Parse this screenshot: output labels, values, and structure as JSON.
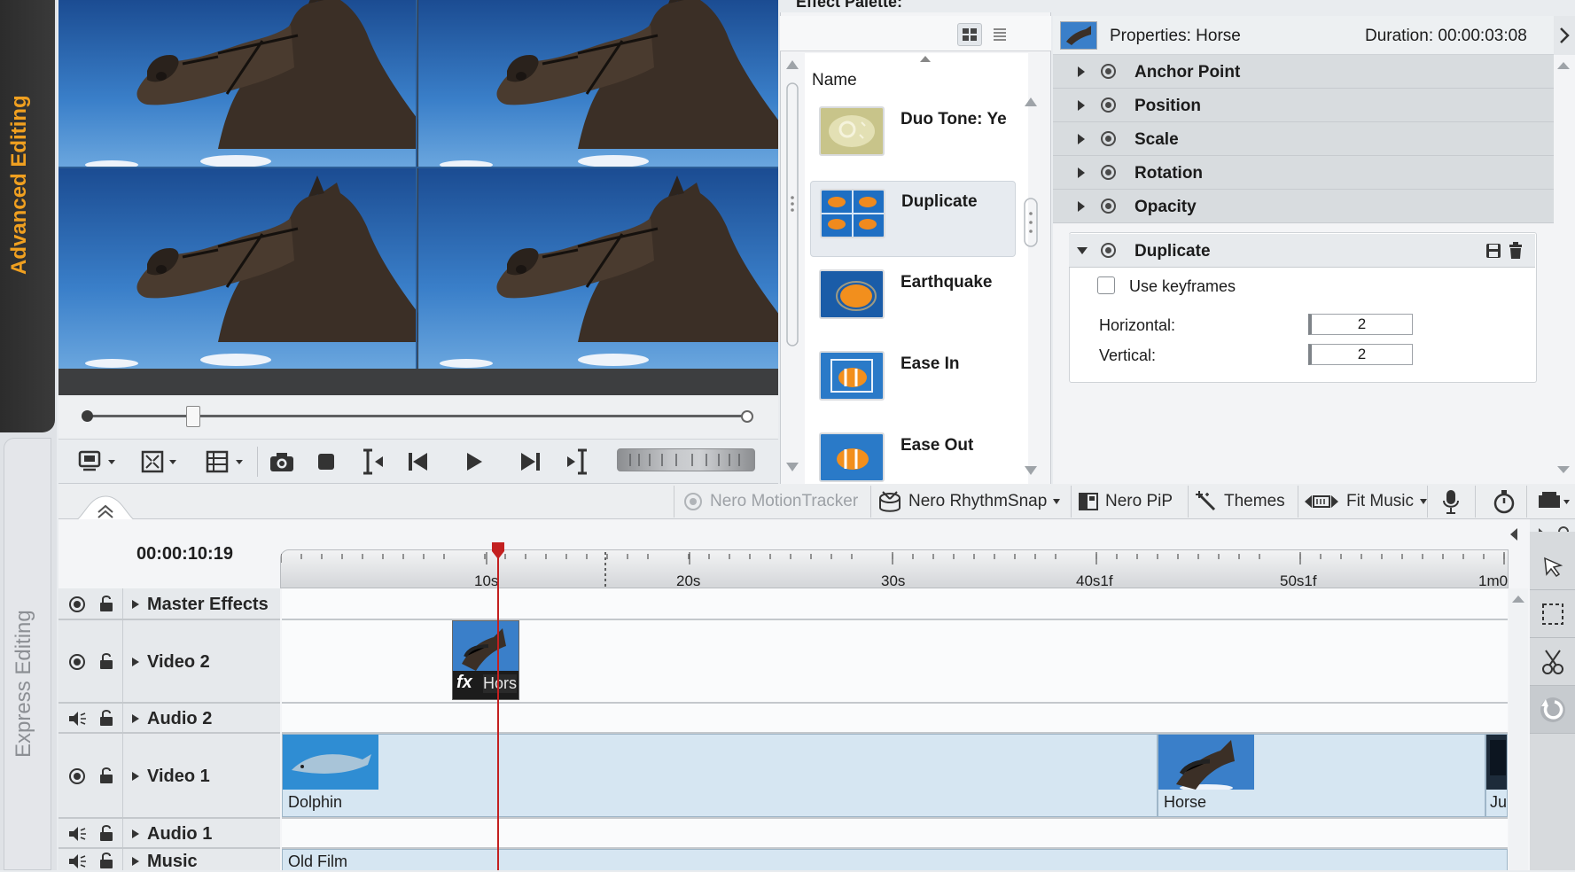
{
  "mode_tabs": {
    "advanced": "Advanced Editing",
    "express": "Express Editing"
  },
  "palette": {
    "title": "Effect Palette:",
    "column_header": "Name",
    "items": [
      {
        "name": "Duo Tone: Ye",
        "thumb": "duotone"
      },
      {
        "name": "Duplicate",
        "thumb": "duplicate",
        "selected": true
      },
      {
        "name": "Earthquake",
        "thumb": "fish"
      },
      {
        "name": "Ease In",
        "thumb": "clownfish"
      },
      {
        "name": "Ease Out",
        "thumb": "clownfish"
      }
    ]
  },
  "properties": {
    "title_prefix": "Properties:",
    "clip_name": "Horse",
    "duration_label": "Duration:",
    "duration_value": "00:00:03:08",
    "groups": [
      "Anchor Point",
      "Position",
      "Scale",
      "Rotation",
      "Opacity"
    ],
    "effect": {
      "name": "Duplicate",
      "use_keyframes_label": "Use keyframes",
      "use_keyframes_checked": false,
      "horizontal_label": "Horizontal:",
      "horizontal_value": "2",
      "vertical_label": "Vertical:",
      "vertical_value": "2"
    }
  },
  "toolbar": {
    "motion_tracker": "Nero MotionTracker",
    "rhythm_snap": "Nero RhythmSnap",
    "pip": "Nero PiP",
    "themes": "Themes",
    "fit_music": "Fit Music"
  },
  "timeline": {
    "timecode": "00:00:10:19",
    "ticks": [
      "10s",
      "20s",
      "30s",
      "40s1f",
      "50s1f",
      "1m0"
    ],
    "tracks": [
      {
        "name": "Master Effects",
        "kind": "fx"
      },
      {
        "name": "Video 2",
        "kind": "video"
      },
      {
        "name": "Audio 2",
        "kind": "audio"
      },
      {
        "name": "Video 1",
        "kind": "video"
      },
      {
        "name": "Audio 1",
        "kind": "audio"
      },
      {
        "name": "Music",
        "kind": "audio"
      }
    ],
    "clips": {
      "video2_clip": {
        "fx": "fx",
        "label": "Hors"
      },
      "video1_dolphin": "Dolphin",
      "video1_horse": "Horse",
      "video1_end": "Ju",
      "music_clip": "Old Film"
    }
  },
  "colors": {
    "accent_tab": "#f0a020",
    "playhead": "#c32020",
    "sky": "#3a7fc9"
  }
}
